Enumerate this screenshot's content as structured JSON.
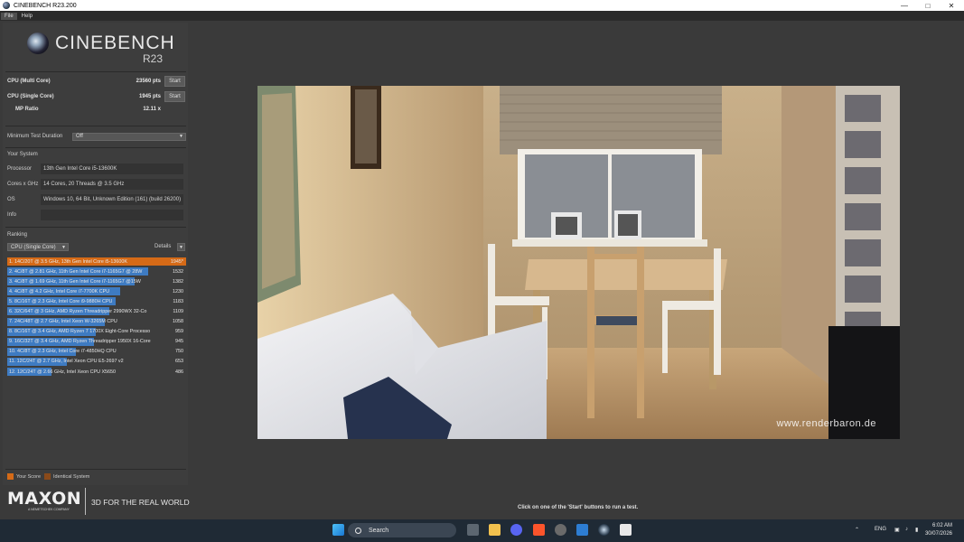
{
  "window": {
    "title": "CINEBENCH R23.200"
  },
  "menu": [
    "File",
    "Help"
  ],
  "logo": {
    "name": "CINEBENCH",
    "version": "R23"
  },
  "scores": {
    "multi_label": "CPU (Multi Core)",
    "multi_value": "23560 pts",
    "single_label": "CPU (Single Core)",
    "single_value": "1945 pts",
    "ratio_label": "MP Ratio",
    "ratio_value": "12.11 x",
    "start_label": "Start"
  },
  "settings": {
    "duration_label": "Minimum Test Duration",
    "duration_value": "Off"
  },
  "system": {
    "heading": "Your System",
    "rows": [
      {
        "label": "Processor",
        "value": "13th Gen Intel Core i5-13600K"
      },
      {
        "label": "Cores x GHz",
        "value": "14 Cores, 20 Threads @ 3.5 GHz"
      },
      {
        "label": "OS",
        "value": "Windows 10, 64 Bit, Unknown Edition (161) (build 26200)"
      },
      {
        "label": "Info",
        "value": ""
      }
    ]
  },
  "ranking": {
    "heading": "Ranking",
    "filter": "CPU (Single Core)",
    "details_label": "Details",
    "items": [
      {
        "text": "1. 14C/20T @ 3.5 GHz, 13th Gen Intel Core i5-13600K",
        "score": "1945*",
        "value": 1945,
        "mine": true
      },
      {
        "text": "2. 4C/8T @ 2.81 GHz, 11th Gen Intel Core i7-1165G7 @ 28W",
        "score": "1532",
        "value": 1532
      },
      {
        "text": "3. 4C/8T @ 1.69 GHz, 11th Gen Intel Core i7-1165G7 @15W",
        "score": "1382",
        "value": 1382
      },
      {
        "text": "4. 4C/8T @ 4.2 GHz, Intel Core i7-7700K CPU",
        "score": "1230",
        "value": 1230
      },
      {
        "text": "5. 8C/16T @ 2.3 GHz, Intel Core i9-9880H CPU",
        "score": "1183",
        "value": 1183
      },
      {
        "text": "6. 32C/64T @ 3 GHz, AMD Ryzen Threadripper 2990WX 32-Co",
        "score": "1109",
        "value": 1109
      },
      {
        "text": "7. 24C/48T @ 2.7 GHz, Intel Xeon W-3265M CPU",
        "score": "1058",
        "value": 1058
      },
      {
        "text": "8. 8C/16T @ 3.4 GHz, AMD Ryzen 7 1700X Eight-Core Processo",
        "score": "959",
        "value": 959
      },
      {
        "text": "9. 16C/32T @ 3.4 GHz, AMD Ryzen Threadripper 1950X 16-Core",
        "score": "945",
        "value": 945
      },
      {
        "text": "10. 4C/8T @ 2.3 GHz, Intel Core i7-4850HQ CPU",
        "score": "750",
        "value": 750
      },
      {
        "text": "11. 12C/24T @ 2.7 GHz, Intel Xeon CPU E5-2697 v2",
        "score": "653",
        "value": 653
      },
      {
        "text": "12. 12C/24T @ 2.66 GHz, Intel Xeon CPU X5650",
        "score": "486",
        "value": 486
      }
    ]
  },
  "legend": {
    "your_score": "Your Score",
    "identical": "Identical System",
    "your_color": "#d56a17",
    "identical_color": "#8a4a1a"
  },
  "brand": {
    "name": "MAXON",
    "sub": "A NEMETSCHEK COMPANY",
    "tagline": "3D FOR THE REAL WORLD"
  },
  "render": {
    "watermark": "www.renderbaron.de"
  },
  "status_text": "Click on one of the 'Start' buttons to run a test.",
  "taskbar": {
    "search_placeholder": "Search",
    "lang": "ENG",
    "time": "6:02 AM",
    "date": "30/07/2026"
  }
}
